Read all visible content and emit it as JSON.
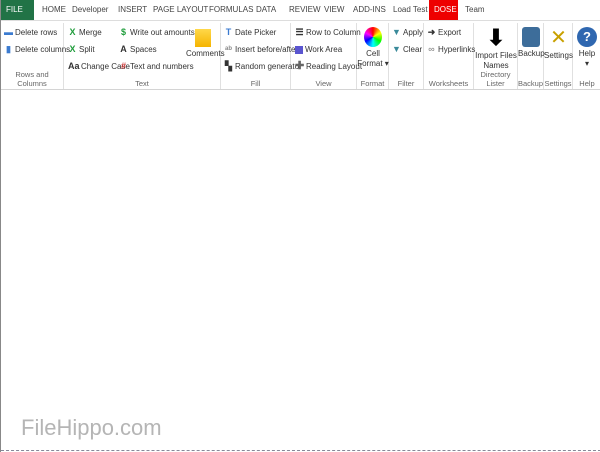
{
  "tabs": [
    "FILE",
    "HOME",
    "Developer",
    "INSERT",
    "PAGE LAYOUT",
    "FORMULAS",
    "DATA",
    "REVIEW",
    "VIEW",
    "ADD-INS",
    "Load Test",
    "DOSE",
    "Team"
  ],
  "groups": {
    "rows": {
      "label": "Rows and Columns",
      "items": [
        "Delete rows",
        "Delete columns"
      ]
    },
    "text": {
      "label": "Text",
      "items": [
        "Merge",
        "Split",
        "Change Case",
        "Write out amounts",
        "Spaces",
        "Text and numbers",
        "Comments"
      ]
    },
    "fill": {
      "label": "Fill",
      "items": [
        "Date Picker",
        "Insert before/after",
        "Random generator"
      ]
    },
    "view": {
      "label": "View",
      "items": [
        "Row to Column",
        "Work Area",
        "Reading Layout"
      ]
    },
    "format": {
      "label": "Format",
      "button": "Cell",
      "button2": "Format"
    },
    "filter": {
      "label": "Filter",
      "items": [
        "Apply",
        "Clear"
      ]
    },
    "worksheets": {
      "label": "Worksheets",
      "items": [
        "Export",
        "Hyperlinks"
      ]
    },
    "dirlister": {
      "label": "Directory Lister",
      "button": "Import Files",
      "button2": "Names"
    },
    "backup": {
      "label": "Backup",
      "button": "Backup"
    },
    "settings": {
      "label": "Settings",
      "button": "Settings"
    },
    "help": {
      "label": "Help",
      "button": "Help"
    }
  },
  "watermark": "FileHippo.com",
  "colors": {
    "file_tab": "#217346",
    "dose_tab": "#e00000"
  }
}
